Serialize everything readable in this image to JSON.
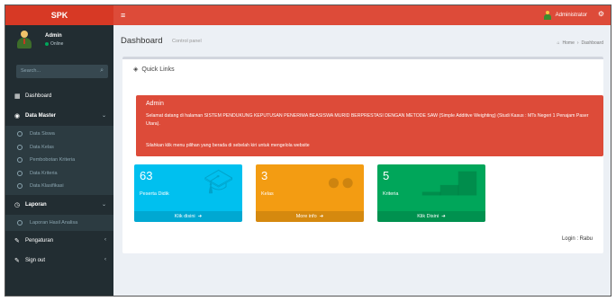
{
  "topbar": {
    "logo": "SPK",
    "toggle": "≡",
    "user": "Administrator"
  },
  "sidebar": {
    "user_name": "Admin",
    "user_status": "Online",
    "search_placeholder": "Search...",
    "menu": {
      "dashboard": "Dashboard",
      "data_master": "Data Master",
      "data_master_items": [
        "Data Siswa",
        "Data Kelas",
        "Pembobotan Kriteria",
        "Data Kriteria",
        "Data Klasifikasi"
      ],
      "laporan": "Laporan",
      "laporan_items": [
        "Laporan Hasil Analisa"
      ],
      "pengaturan": "Pengaturan",
      "sign_out": "Sign out"
    }
  },
  "header": {
    "title": "Dashboard",
    "subtitle": "Control panel",
    "breadcrumb_home": "Home",
    "breadcrumb_current": "Dashboard"
  },
  "box": {
    "title": "Quick Links"
  },
  "callout": {
    "title": "Admin",
    "text": "Selamat datang di halaman SISTEM PENDUKUNG KEPUTUSAN PENERIMA BEASISWA MURID BERPRESTASI DENGAN METODE SAW (Simple Additive Weighting) (Studi Kasus : MTs Negeri 1 Penajam Paser Utara).",
    "note": "Silahkan klik menu pilihan yang berada di sebelah kiri untuk mengelola website"
  },
  "tiles": [
    {
      "count": "63",
      "label": "Peserta Didik",
      "footer": "Klik disini",
      "icon": "graduation-cap-icon"
    },
    {
      "count": "3",
      "label": "Kelas",
      "footer": "More info",
      "icon": "users-icon"
    },
    {
      "count": "5",
      "label": "Kriteria",
      "footer": "Klik Disini",
      "icon": "bar-chart-icon"
    }
  ],
  "login_text": "Login : Rabu",
  "colors": {
    "logo": "#d73925",
    "navbar": "#dd4b39",
    "sidebar": "#222d32",
    "tile_aqua": "#00c0ef",
    "tile_orange": "#f39c12",
    "tile_green": "#00a65a"
  }
}
